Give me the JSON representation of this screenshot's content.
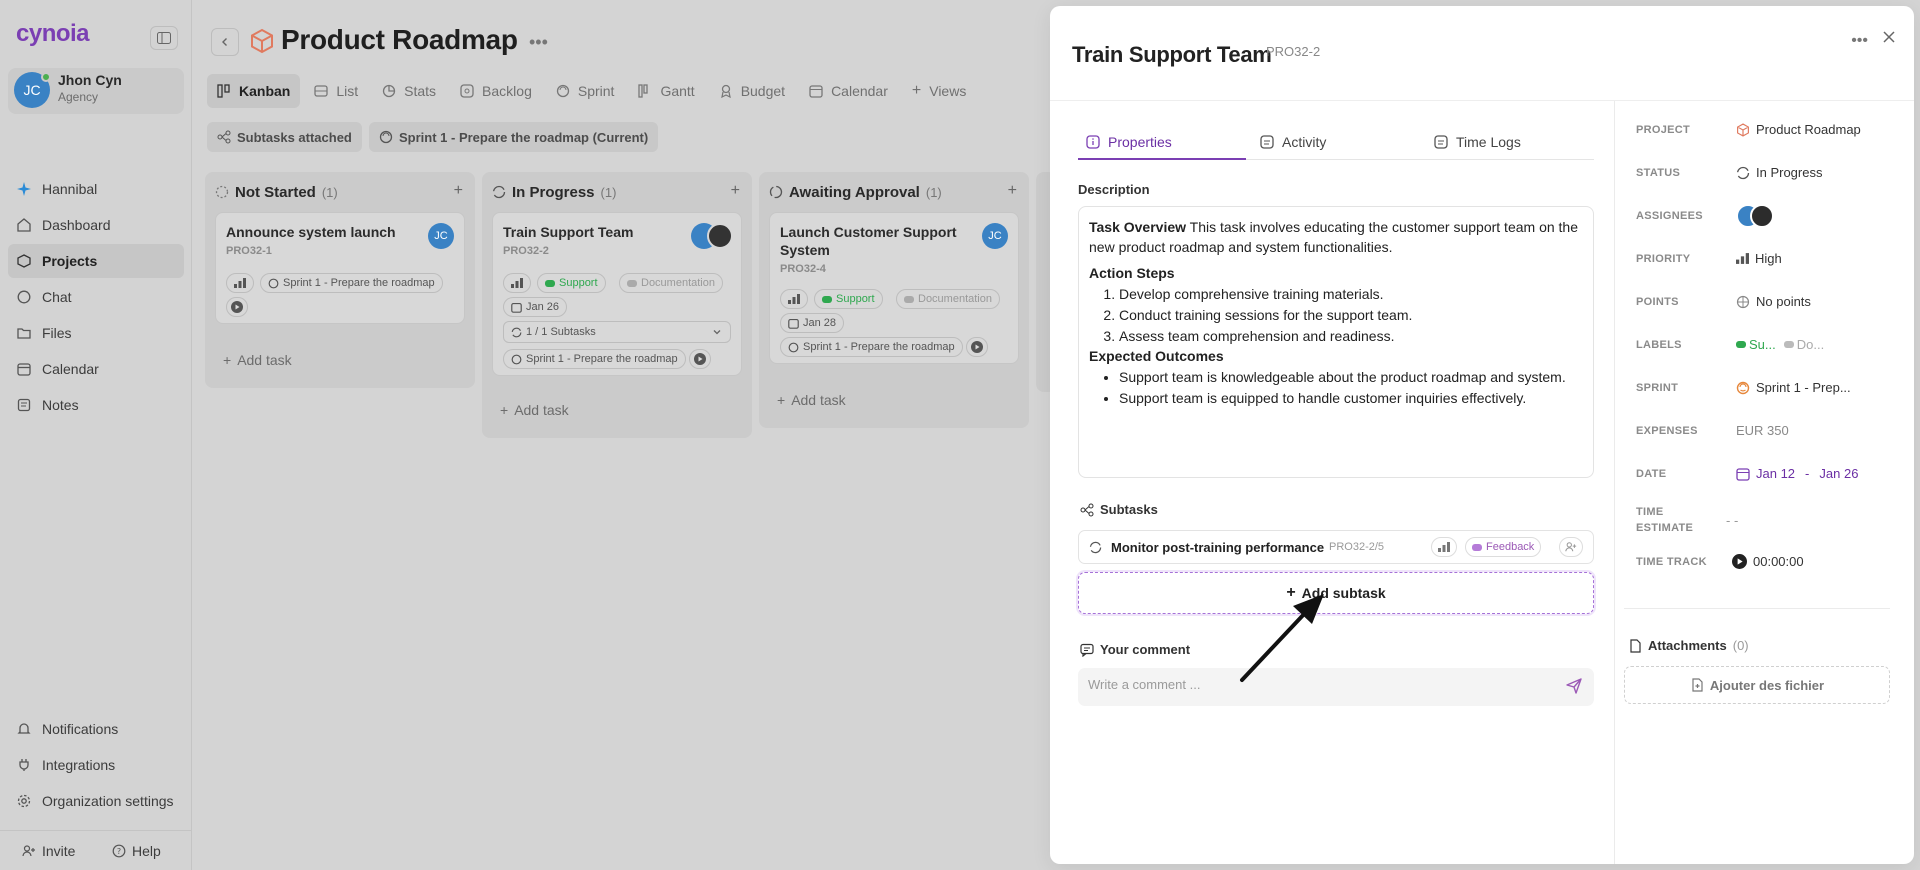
{
  "sidebar": {
    "logo": "cynoia",
    "user": {
      "initials": "JC",
      "name": "Jhon Cyn",
      "role": "Agency"
    },
    "items": [
      {
        "label": "Hannibal"
      },
      {
        "label": "Dashboard"
      },
      {
        "label": "Projects"
      },
      {
        "label": "Chat"
      },
      {
        "label": "Files"
      },
      {
        "label": "Calendar"
      },
      {
        "label": "Notes"
      }
    ],
    "bottom_items": [
      {
        "label": "Notifications"
      },
      {
        "label": "Integrations"
      },
      {
        "label": "Organization settings"
      }
    ],
    "footer": {
      "invite": "Invite",
      "help": "Help"
    }
  },
  "main": {
    "title": "Product Roadmap",
    "view_tabs": [
      "Kanban",
      "List",
      "Stats",
      "Backlog",
      "Sprint",
      "Gantt",
      "Budget",
      "Calendar",
      "Views"
    ],
    "filters": [
      "Subtasks attached",
      "Sprint 1 - Prepare the roadmap (Current)"
    ],
    "columns": [
      {
        "name": "Not Started",
        "count": "(1)",
        "cards": [
          {
            "title": "Announce system launch",
            "id": "PRO32-1",
            "assignee": "JC",
            "sprint": "Sprint 1 - Prepare the roadmap"
          }
        ],
        "add_label": "Add task"
      },
      {
        "name": "In Progress",
        "count": "(1)",
        "cards": [
          {
            "title": "Train Support Team",
            "id": "PRO32-2",
            "labels": [
              "Support",
              "Documentation"
            ],
            "date": "Jan 26",
            "subtasks": "1 / 1 Subtasks",
            "sprint": "Sprint 1 - Prepare the roadmap"
          }
        ],
        "add_label": "Add task"
      },
      {
        "name": "Awaiting Approval",
        "count": "(1)",
        "cards": [
          {
            "title": "Launch Customer Support System",
            "id": "PRO32-4",
            "assignee": "JC",
            "labels": [
              "Support",
              "Documentation"
            ],
            "date": "Jan 28",
            "sprint": "Sprint 1 - Prepare the roadmap"
          }
        ],
        "add_label": "Add task"
      }
    ]
  },
  "panel": {
    "title": "Train Support Team",
    "id": "PRO32-2",
    "tabs": [
      "Properties",
      "Activity",
      "Time Logs"
    ],
    "description_label": "Description",
    "description": {
      "overview_title": "Task Overview",
      "overview_text": "This task involves educating the customer support team on the new product roadmap and system functionalities.",
      "steps_title": "Action Steps",
      "steps": [
        "Develop comprehensive training materials.",
        "Conduct training sessions for the support team.",
        "Assess team comprehension and readiness."
      ],
      "outcomes_title": "Expected Outcomes",
      "outcomes": [
        "Support team is knowledgeable about the product roadmap and system.",
        "Support team is equipped to handle customer inquiries effectively."
      ]
    },
    "subtasks_label": "Subtasks",
    "subtasks": [
      {
        "title": "Monitor post-training performance",
        "id": "PRO32-2/5",
        "label": "Feedback"
      }
    ],
    "add_subtask": "Add subtask",
    "comment_label": "Your comment",
    "comment_placeholder": "Write a comment ...",
    "properties": {
      "project_label": "PROJECT",
      "project": "Product Roadmap",
      "status_label": "STATUS",
      "status": "In Progress",
      "assignees_label": "ASSIGNEES",
      "priority_label": "PRIORITY",
      "priority": "High",
      "points_label": "POINTS",
      "points": "No points",
      "labels_label": "LABELS",
      "label1": "Su...",
      "label2": "Do...",
      "sprint_label": "SPRINT",
      "sprint": "Sprint 1 - Prep...",
      "expenses_label": "EXPENSES",
      "expenses": "EUR 350",
      "date_label": "DATE",
      "date_start": "Jan 12",
      "date_sep": "-",
      "date_end": "Jan 26",
      "time_estimate_label_1": "TIME",
      "time_estimate_label_2": "ESTIMATE",
      "time_estimate": "- -",
      "time_track_label": "TIME TRACK",
      "time_track": "00:00:00"
    },
    "attachments_label": "Attachments",
    "attachments_count": "(0)",
    "attach_button": "Ajouter des fichier"
  },
  "colors": {
    "accent": "#7b3fb3",
    "support": "#2fa84f",
    "feedback": "#9b59b6",
    "avatar": "#3a82c4",
    "date": "#6b2fa4"
  }
}
